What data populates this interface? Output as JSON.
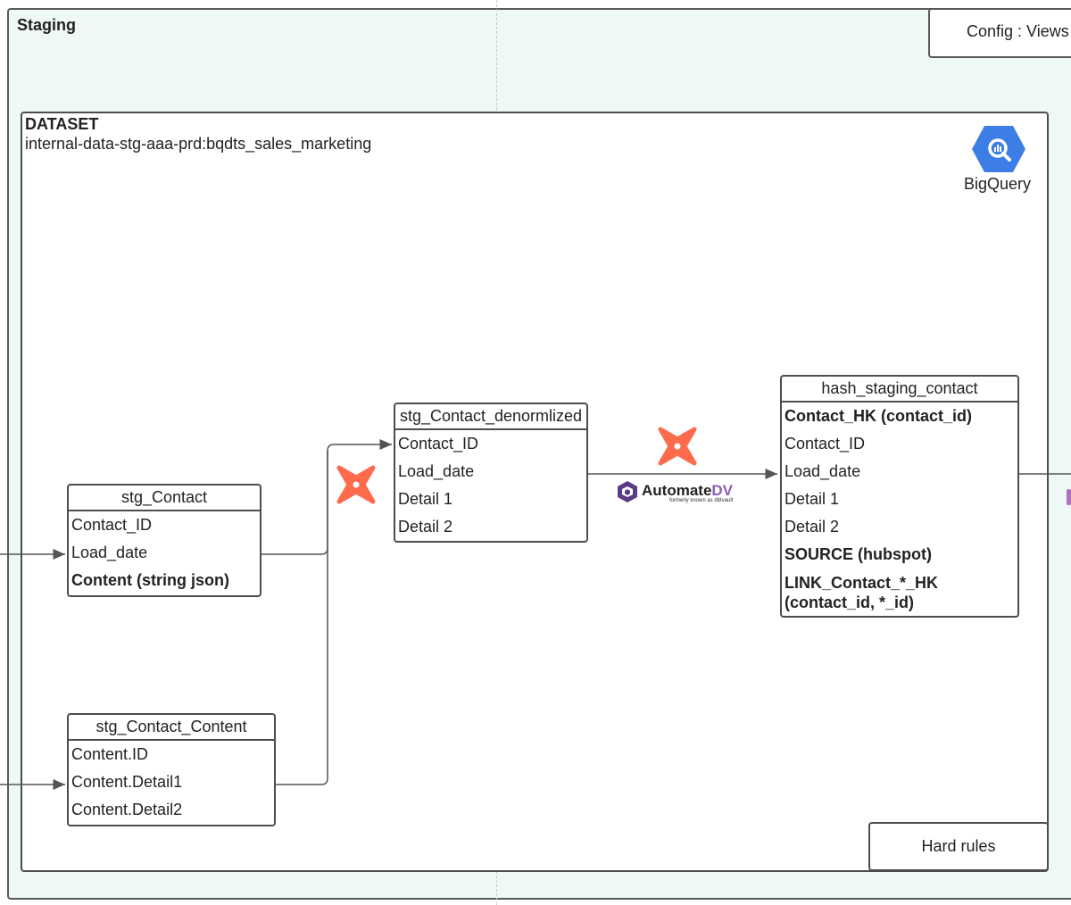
{
  "stage": {
    "title": "Staging"
  },
  "config": {
    "label": "Config : Views"
  },
  "dataset": {
    "title": "DATASET",
    "name": "internal-data-stg-aaa-prd:bqdts_sales_marketing"
  },
  "bigquery": {
    "label": "BigQuery",
    "icon": "bigquery-icon",
    "color": "#3d7ee6"
  },
  "tables": {
    "stg_contact": {
      "name": "stg_Contact",
      "rows": [
        "Contact_ID",
        "Load_date",
        "Content (string json)"
      ]
    },
    "stg_contact_content": {
      "name": "stg_Contact_Content",
      "rows": [
        "Content.ID",
        "Content.Detail1",
        "Content.Detail2"
      ]
    },
    "stg_contact_denorm": {
      "name": "stg_Contact_denormlized",
      "rows": [
        "Contact_ID",
        "Load_date",
        "Detail 1",
        "Detail 2"
      ]
    },
    "hash_staging_contact": {
      "name": "hash_staging_contact",
      "rows": [
        "Contact_HK (contact_id)",
        "Contact_ID",
        "Load_date",
        "Detail 1",
        "Detail 2",
        "SOURCE (hubspot)",
        "LINK_Contact_*_HK",
        "(contact_id, *_id)"
      ]
    }
  },
  "automate_dv": {
    "name_prefix": "Automate",
    "name_suffix": "DV",
    "subtitle": "formerly known as dbtvault",
    "color": "#8e5fb3"
  },
  "dbt": {
    "icon": "dbt-icon",
    "color": "#fe6b4c"
  },
  "hard_rules": {
    "label": "Hard rules"
  }
}
